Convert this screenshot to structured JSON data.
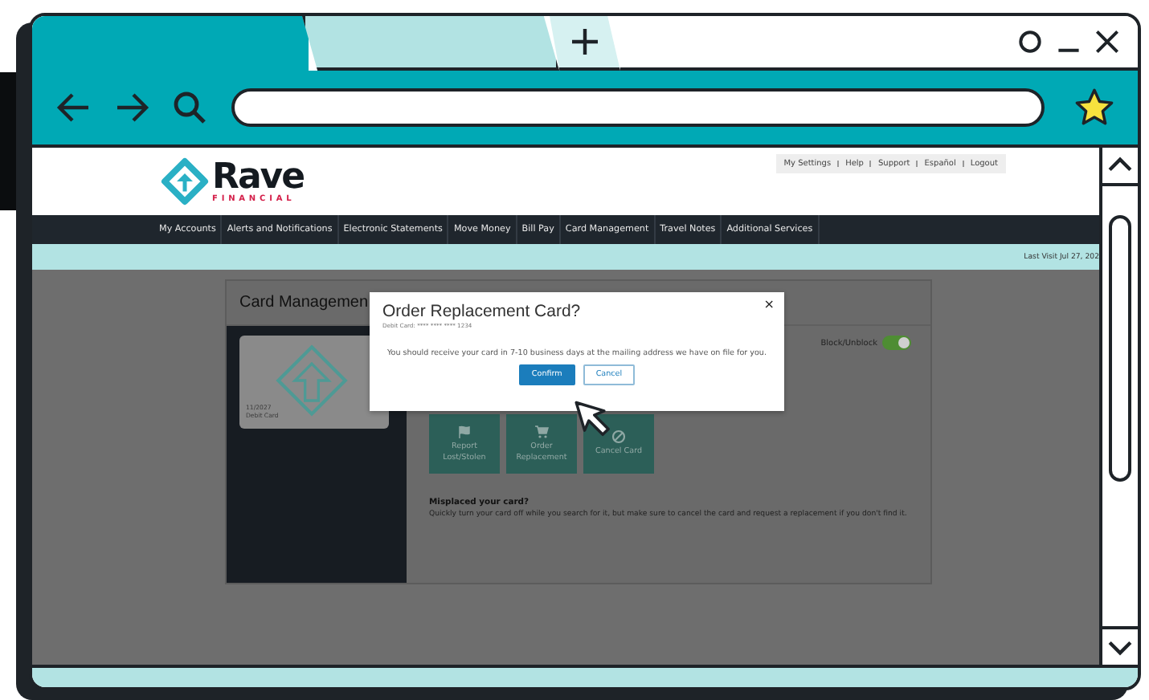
{
  "browser": {
    "tabs": [
      {
        "kind": "page",
        "selected": true
      },
      {
        "kind": "page",
        "selected": false
      },
      {
        "kind": "new",
        "selected": false
      }
    ]
  },
  "site": {
    "logo": {
      "name": "Rave",
      "tagline": "FINANCIAL"
    },
    "top_links": [
      "My Settings",
      "Help",
      "Support",
      "Español",
      "Logout"
    ],
    "nav": [
      "My Accounts",
      "Alerts and Notifications",
      "Electronic Statements",
      "Move Money",
      "Bill Pay",
      "Card Management",
      "Travel Notes",
      "Additional Services"
    ],
    "last_visit": "Last Visit Jul 27, 202",
    "card_management": {
      "title": "Card Managemen",
      "card": {
        "expiry": "11/2027",
        "type": "Debit Card"
      },
      "block_toggle": {
        "label": "Block/Unblock",
        "on": true
      },
      "actions": [
        {
          "kind": "report",
          "label": "Report Lost/Stolen"
        },
        {
          "kind": "order",
          "label": "Order Replacement"
        },
        {
          "kind": "cancel",
          "label": "Cancel Card"
        }
      ],
      "misplaced": {
        "heading": "Misplaced your card?",
        "text": "Quickly turn your card off while you search for it, but make sure to cancel the card and request a replacement if you don't find it."
      }
    }
  },
  "modal": {
    "title": "Order Replacement Card?",
    "subtitle": "Debit Card: **** **** **** 1234",
    "close": "×",
    "message": "You should receive your card in 7-10 business days at the mailing address we have on file for you.",
    "buttons": [
      {
        "kind": "primary",
        "label": "Confirm"
      },
      {
        "kind": "secondary",
        "label": "Cancel"
      }
    ]
  }
}
